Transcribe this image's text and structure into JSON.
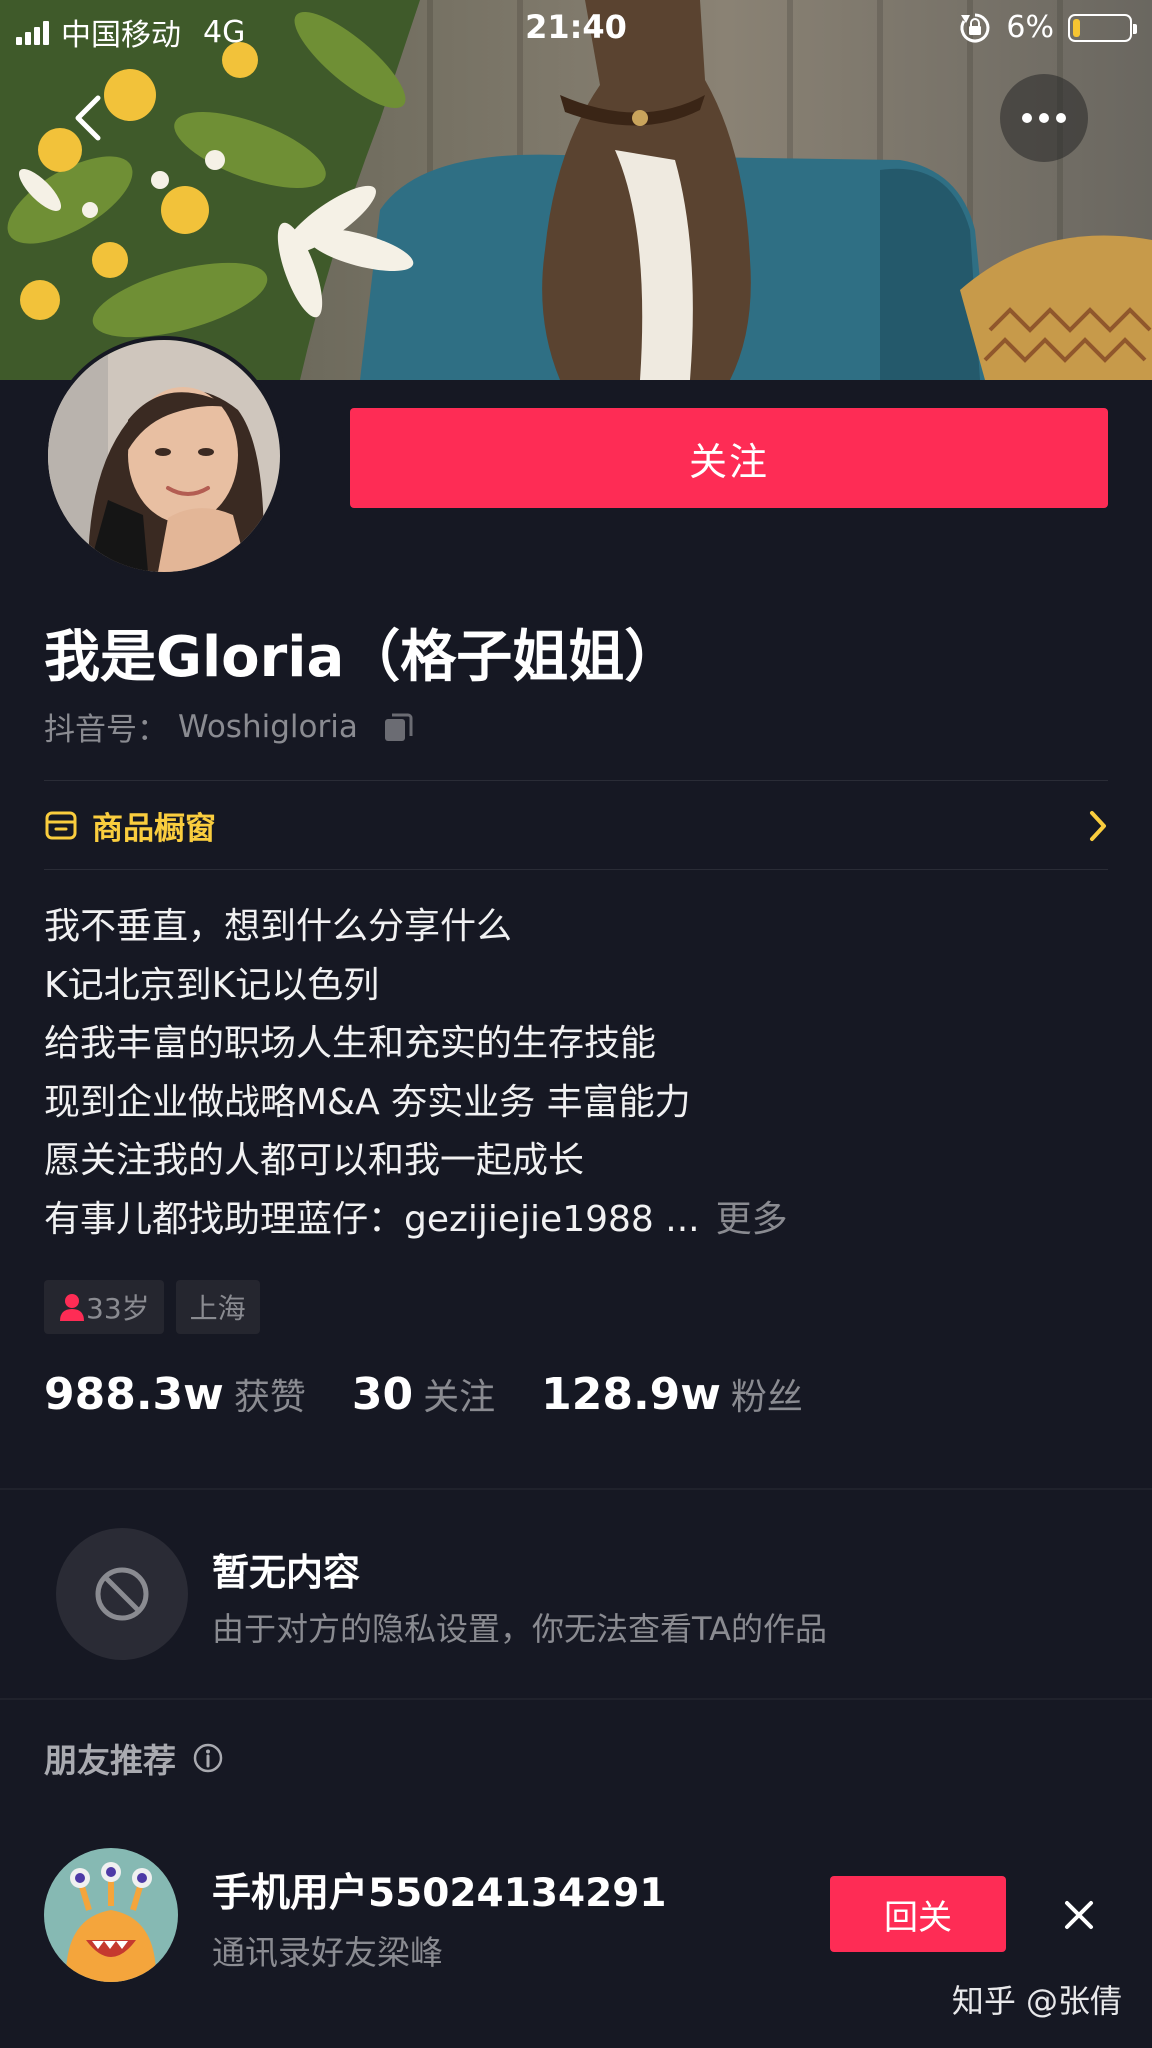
{
  "status_bar": {
    "carrier": "中国移动",
    "network": "4G",
    "time": "21:40",
    "battery_percent": "6%",
    "battery_level": 0.06
  },
  "profile": {
    "follow_label": "关注",
    "name": "我是Gloria（格子姐姐）",
    "douyin_id_label": "抖音号：",
    "douyin_id": "Woshigloria"
  },
  "shop": {
    "label": "商品橱窗"
  },
  "bio": {
    "lines": [
      "我不垂直，想到什么分享什么",
      "K记北京到K记以色列",
      "给我丰富的职场人生和充实的生存技能",
      "现到企业做战略M&A 夯实业务 丰富能力",
      "愿关注我的人都可以和我一起成长",
      "有事儿都找助理蓝仔：gezijiejie1988 ..."
    ],
    "more_label": "更多"
  },
  "tags": {
    "age": "33岁",
    "location": "上海"
  },
  "stats": {
    "likes_value": "988.3w",
    "likes_label": "获赞",
    "following_value": "30",
    "following_label": "关注",
    "followers_value": "128.9w",
    "followers_label": "粉丝"
  },
  "empty": {
    "title": "暂无内容",
    "description": "由于对方的隐私设置，你无法查看TA的作品"
  },
  "friends": {
    "title": "朋友推荐",
    "items": [
      {
        "name": "手机用户55024134291",
        "subtitle": "通讯录好友梁峰",
        "button": "回关"
      }
    ]
  },
  "watermark": "知乎 @张倩",
  "colors": {
    "background": "#161823",
    "accent": "#fe2c55",
    "shop": "#facd3e",
    "muted": "#8a8b91"
  },
  "icons": [
    "back-icon",
    "more-icon",
    "copy-icon",
    "shop-icon",
    "chevron-right-icon",
    "gender-female-icon",
    "block-icon",
    "info-icon",
    "close-icon"
  ]
}
